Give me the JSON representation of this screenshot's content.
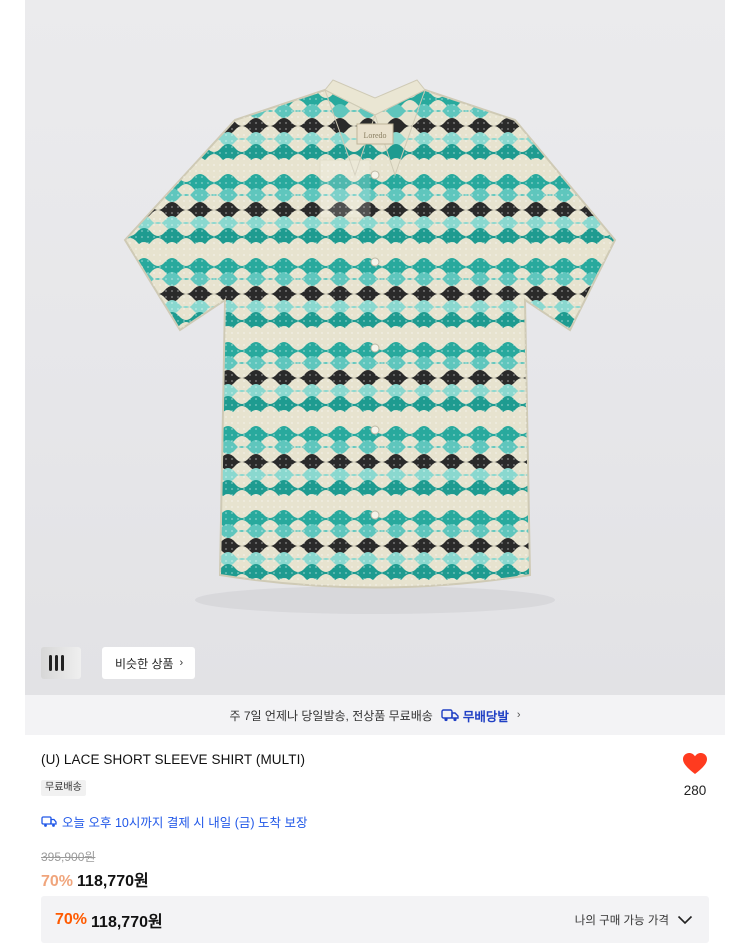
{
  "product": {
    "title": "(U) LACE SHORT SLEEVE SHIRT (MULTI)",
    "free_shipping_tag": "무료배송",
    "likes": "280",
    "original_price": "395,900원",
    "discount_rate": "70%",
    "sale_price": "118,770원"
  },
  "image": {
    "similar_button_label": "비슷한 상품",
    "shirt_label_text": "Loredo"
  },
  "delivery": {
    "banner_text": "주 7일 언제나 당일발송, 전상품 무료배송",
    "badge_label": "무배당발",
    "tomorrow_text": "오늘 오후 10시까지 결제 시 내일 (금) 도착 보장"
  },
  "my_price": {
    "discount_rate": "70%",
    "price": "118,770원",
    "label": "나의 구매 가능 가격"
  },
  "colors": {
    "accent_blue": "#2158e8",
    "discount_orange": "#ff5a00",
    "heart_red": "#ff3b1f"
  }
}
